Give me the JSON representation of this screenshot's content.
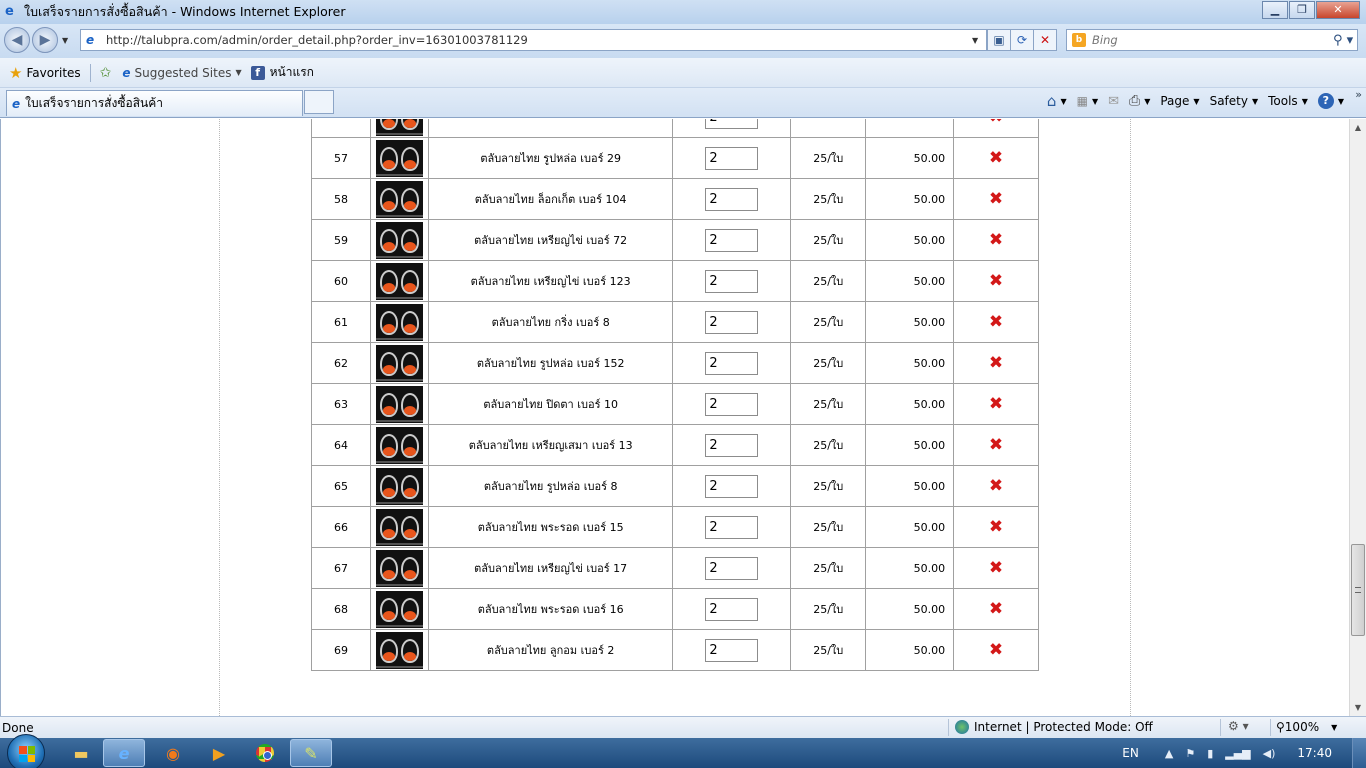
{
  "window": {
    "title": "ใบเสร็จรายการสั่งซื้อสินค้า - Windows Internet Explorer"
  },
  "nav": {
    "url": "http://talubpra.com/admin/order_detail.php?order_inv=16301003781129",
    "search_placeholder": "Bing"
  },
  "favorites": {
    "favorites_label": "Favorites",
    "suggested_label": "Suggested Sites",
    "facebook_label": "หน้าแรก"
  },
  "tab": {
    "title": "ใบเสร็จรายการสั่งซื้อสินค้า"
  },
  "commandbar": {
    "page_label": "Page",
    "safety_label": "Safety",
    "tools_label": "Tools"
  },
  "order_rows": [
    {
      "num": "",
      "name": "",
      "qty": "2",
      "unit": "",
      "price": ""
    },
    {
      "num": "57",
      "name": "ตลับลายไทย รูปหล่อ เบอร์ 29",
      "qty": "2",
      "unit": "25/ใบ",
      "price": "50.00"
    },
    {
      "num": "58",
      "name": "ตลับลายไทย ล็อกเก็ต เบอร์ 104",
      "qty": "2",
      "unit": "25/ใบ",
      "price": "50.00"
    },
    {
      "num": "59",
      "name": "ตลับลายไทย เหรียญไข่ เบอร์ 72",
      "qty": "2",
      "unit": "25/ใบ",
      "price": "50.00"
    },
    {
      "num": "60",
      "name": "ตลับลายไทย เหรียญไข่ เบอร์ 123",
      "qty": "2",
      "unit": "25/ใบ",
      "price": "50.00"
    },
    {
      "num": "61",
      "name": "ตลับลายไทย กริ่ง เบอร์ 8",
      "qty": "2",
      "unit": "25/ใบ",
      "price": "50.00"
    },
    {
      "num": "62",
      "name": "ตลับลายไทย รูปหล่อ เบอร์ 152",
      "qty": "2",
      "unit": "25/ใบ",
      "price": "50.00"
    },
    {
      "num": "63",
      "name": "ตลับลายไทย ปิดตา เบอร์ 10",
      "qty": "2",
      "unit": "25/ใบ",
      "price": "50.00"
    },
    {
      "num": "64",
      "name": "ตลับลายไทย เหรียญเสมา เบอร์ 13",
      "qty": "2",
      "unit": "25/ใบ",
      "price": "50.00"
    },
    {
      "num": "65",
      "name": "ตลับลายไทย รูปหล่อ เบอร์ 8",
      "qty": "2",
      "unit": "25/ใบ",
      "price": "50.00"
    },
    {
      "num": "66",
      "name": "ตลับลายไทย พระรอด เบอร์ 15",
      "qty": "2",
      "unit": "25/ใบ",
      "price": "50.00"
    },
    {
      "num": "67",
      "name": "ตลับลายไทย เหรียญไข่ เบอร์ 17",
      "qty": "2",
      "unit": "25/ใบ",
      "price": "50.00"
    },
    {
      "num": "68",
      "name": "ตลับลายไทย พระรอด เบอร์ 16",
      "qty": "2",
      "unit": "25/ใบ",
      "price": "50.00"
    },
    {
      "num": "69",
      "name": "ตลับลายไทย ลูกอม เบอร์ 2",
      "qty": "2",
      "unit": "25/ใบ",
      "price": "50.00"
    }
  ],
  "delete_glyph": "✖",
  "status": {
    "left": "Done",
    "zone": "Internet | Protected Mode: Off",
    "zoom": "100%"
  },
  "taskbar": {
    "lang": "EN",
    "clock": "17:40"
  },
  "icons": [
    "ie-icon",
    "back-icon",
    "forward-icon",
    "refresh-icon",
    "stop-icon",
    "search-icon",
    "star-icon",
    "facebook-icon",
    "home-icon",
    "feed-icon",
    "mail-icon",
    "print-icon",
    "help-icon",
    "delete-icon",
    "globe-icon",
    "windows-start-icon",
    "firefox-icon",
    "chrome-icon"
  ],
  "colors": {
    "delete": "#d31818",
    "taskbar": "#1d4a7c",
    "chrome_bar": "#c8dbf1"
  }
}
